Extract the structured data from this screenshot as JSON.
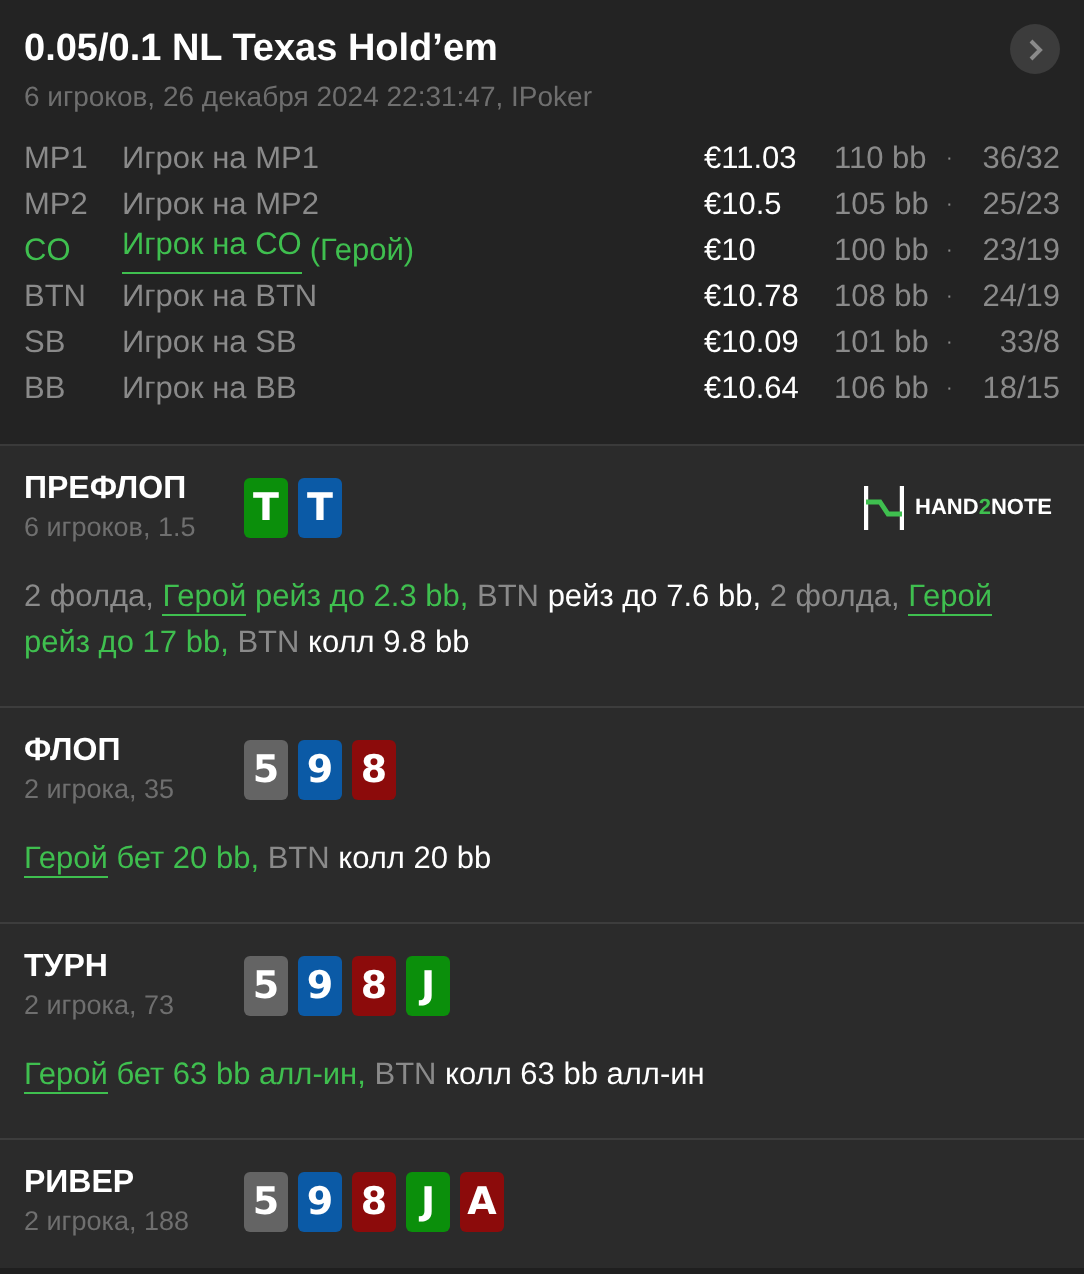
{
  "header": {
    "title": "0.05/0.1 NL Texas Hold’em",
    "subtitle": "6 игроков, 26 декабря 2024 22:31:47, IPoker"
  },
  "players": [
    {
      "position": "MP1",
      "name": "Игрок на MP1",
      "hero": false,
      "stack": "€11.03",
      "bb": "110 bb",
      "separator": "·",
      "stats": "36/32"
    },
    {
      "position": "MP2",
      "name": "Игрок на MP2",
      "hero": false,
      "stack": "€10.5",
      "bb": "105 bb",
      "separator": "·",
      "stats": "25/23"
    },
    {
      "position": "CO",
      "name": "Игрок на CO",
      "hero": true,
      "hero_tag": "(Герой)",
      "stack": "€10",
      "bb": "100 bb",
      "separator": "·",
      "stats": "23/19"
    },
    {
      "position": "BTN",
      "name": "Игрок на BTN",
      "hero": false,
      "stack": "€10.78",
      "bb": "108 bb",
      "separator": "·",
      "stats": "24/19"
    },
    {
      "position": "SB",
      "name": "Игрок на SB",
      "hero": false,
      "stack": "€10.09",
      "bb": "101 bb",
      "separator": "·",
      "stats": "33/8"
    },
    {
      "position": "BB",
      "name": "Игрок на BB",
      "hero": false,
      "stack": "€10.64",
      "bb": "106 bb",
      "separator": "·",
      "stats": "18/15"
    }
  ],
  "logo": {
    "before": "HAND",
    "accent": "2",
    "after": "NOTE"
  },
  "streets": [
    {
      "name": "ПРЕФЛОП",
      "info": "6 игроков, 1.5",
      "cards": [
        {
          "rank": "T",
          "color": "#0b8f0b"
        },
        {
          "rank": "T",
          "color": "#0b5aa6"
        }
      ],
      "actions": [
        {
          "kind": "fold",
          "text": "2 фолда,"
        },
        {
          "kind": "hero",
          "actor": "Герой",
          "text": "рейз до 2.3 bb,"
        },
        {
          "kind": "player",
          "actor": "BTN",
          "text": "рейз до 7.6 bb,"
        },
        {
          "kind": "fold",
          "text": "2 фолда,"
        },
        {
          "kind": "hero",
          "actor": "Герой",
          "text": "рейз до 17 bb,"
        },
        {
          "kind": "player",
          "actor": "BTN",
          "text": "колл 9.8 bb"
        }
      ]
    },
    {
      "name": "ФЛОП",
      "info": "2 игрока, 35",
      "cards": [
        {
          "rank": "5",
          "color": "#646464"
        },
        {
          "rank": "9",
          "color": "#0b5aa6"
        },
        {
          "rank": "8",
          "color": "#8c0b0b"
        }
      ],
      "actions": [
        {
          "kind": "hero",
          "actor": "Герой",
          "text": "бет 20 bb,"
        },
        {
          "kind": "player",
          "actor": "BTN",
          "text": "колл 20 bb"
        }
      ]
    },
    {
      "name": "ТУРН",
      "info": "2 игрока, 73",
      "cards": [
        {
          "rank": "5",
          "color": "#646464"
        },
        {
          "rank": "9",
          "color": "#0b5aa6"
        },
        {
          "rank": "8",
          "color": "#8c0b0b"
        },
        {
          "rank": "J",
          "color": "#0b8f0b"
        }
      ],
      "actions": [
        {
          "kind": "hero",
          "actor": "Герой",
          "text": "бет 63 bb алл-ин,"
        },
        {
          "kind": "player",
          "actor": "BTN",
          "text": "колл 63 bb алл-ин"
        }
      ]
    },
    {
      "name": "РИВЕР",
      "info": "2 игрока, 188",
      "cards": [
        {
          "rank": "5",
          "color": "#646464"
        },
        {
          "rank": "9",
          "color": "#0b5aa6"
        },
        {
          "rank": "8",
          "color": "#8c0b0b"
        },
        {
          "rank": "J",
          "color": "#0b8f0b"
        },
        {
          "rank": "A",
          "color": "#8c0b0b"
        }
      ]
    }
  ]
}
